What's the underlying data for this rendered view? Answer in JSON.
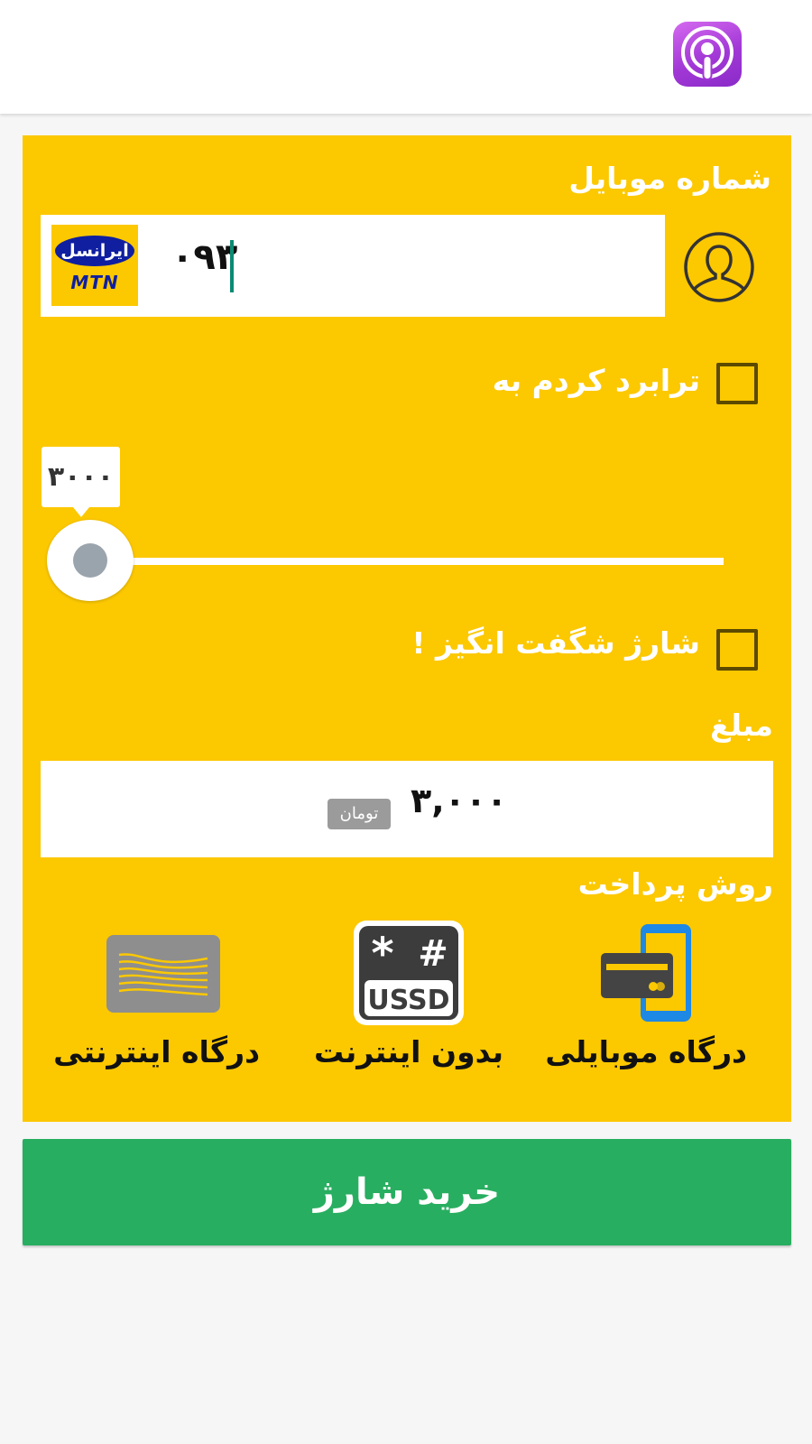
{
  "header": {
    "app_icon": "podcast-icon",
    "app_icon_color": "#a238d6"
  },
  "form": {
    "background_color": "#fcc800",
    "mobile_label": "شماره موبایل",
    "phone_value": "۰۹۳",
    "operator_logo": {
      "name_fa": "ایرانسل",
      "name_en": "MTN"
    },
    "contact_icon": "person-icon",
    "transfer_label": "ترابرد کردم به",
    "transfer_checked": false,
    "slider": {
      "value_label": "۳۰۰۰",
      "value": 3000
    },
    "amazing_label": "شارژ شگفت انگیز !",
    "amazing_checked": false,
    "amount_label": "مبلغ",
    "amount_value": "۳,۰۰۰",
    "amount_unit": "تومان",
    "payment_title": "روش پرداخت",
    "payment_methods": [
      {
        "label": "درگاه موبایلی",
        "icon": "mobile-card-icon"
      },
      {
        "label": "بدون اینترنت",
        "icon": "ussd-icon",
        "icon_text": "USSD"
      },
      {
        "label": "درگاه اینترنتی",
        "icon": "shetab-card-icon"
      }
    ]
  },
  "buy_button": {
    "label": "خرید شارژ",
    "color": "#28ae60"
  }
}
